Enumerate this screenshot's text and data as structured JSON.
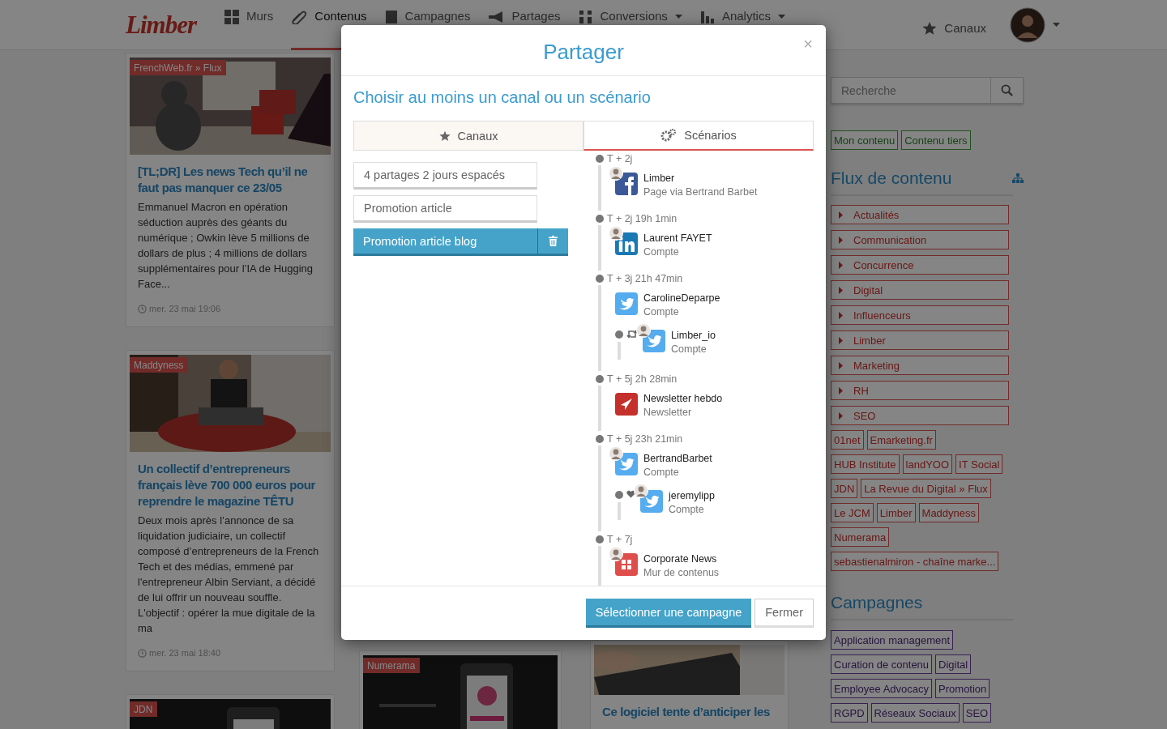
{
  "nav": {
    "logo": "Limber",
    "items": [
      {
        "label": "Murs",
        "selected": false,
        "dropdown": false
      },
      {
        "label": "Contenus",
        "selected": true,
        "dropdown": false
      },
      {
        "label": "Campagnes",
        "selected": false,
        "dropdown": false
      },
      {
        "label": "Partages",
        "selected": false,
        "dropdown": false
      },
      {
        "label": "Conversions",
        "selected": false,
        "dropdown": true
      },
      {
        "label": "Analytics",
        "selected": false,
        "dropdown": true
      }
    ],
    "channels": "Canaux"
  },
  "feed": {
    "columns": [
      {
        "cards": [
          {
            "source": "FrenchWeb.fr » Flux",
            "title": "[TL;DR] Les news Tech qu’il ne faut pas manquer ce 23/05",
            "excerpt": "Emmanuel Macron en opération séduction auprès des géants du numérique ; Owkin lève 5 millions de dollars de plus ; 4 millions de dollars supplémentaires pour l’IA de Hugging Face...",
            "date": "mer. 23 mai 19:06"
          },
          {
            "source": "Maddyness",
            "title": "Un collectif d’entrepreneurs français lève 700 000 euros pour reprendre le magazine TÊTU",
            "excerpt": "Deux mois après l’annonce de sa liquidation judiciaire, un collectif composé d’entrepreneurs de la French Tech et des médias, emmené par l'entrepreneur Albin Serviant, a décidé de lui offrir un nouveau souffle. L'objectif : opérer la mue digitale de la ma",
            "date": "mer. 23 mai 18:40"
          },
          {
            "source": "JDN"
          }
        ]
      },
      {
        "cards": [
          {
            "source": "Numerama"
          }
        ]
      },
      {
        "cards": [
          {
            "title": "Ce logiciel tente d’anticiper les"
          }
        ]
      }
    ]
  },
  "sidebar": {
    "search": {
      "placeholder": "Recherche"
    },
    "filters": [
      "Mon contenu",
      "Contenu tiers"
    ],
    "flux_title": "Flux de contenu",
    "folders": [
      "Actualités",
      "Communication",
      "Concurrence",
      "Digital",
      "Influenceurs",
      "Limber",
      "Marketing",
      "RH",
      "SEO"
    ],
    "sources": [
      "01net",
      "Emarketing.fr",
      "HUB Institute",
      "landYOO",
      "IT Social",
      "JDN",
      "La Revue du Digital » Flux",
      "Le JCM",
      "Limber",
      "Maddyness",
      "Numerama",
      "sebastienalmiron - chaîne marke..."
    ],
    "campaigns_title": "Campagnes",
    "campaigns": [
      "Application management",
      "Curation de contenu",
      "Digital",
      "Employee Advocacy",
      "Promotion",
      "RGPD",
      "Réseaux Sociaux",
      "SEO"
    ]
  },
  "modal": {
    "title": "Partager",
    "close": "×",
    "subtitle": "Choisir au moins un canal ou un scénario",
    "tabs": [
      {
        "label": "Canaux",
        "selected": false
      },
      {
        "label": "Scénarios",
        "selected": true
      }
    ],
    "scenarios": [
      {
        "label": "4 partages 2 jours espacés",
        "selected": false
      },
      {
        "label": "Promotion article",
        "selected": false
      },
      {
        "label": "Promotion article blog",
        "selected": true
      }
    ],
    "timeline": [
      {
        "time": "T + 2j",
        "entries": [
          {
            "kind": "facebook",
            "avatar": true,
            "name": "Limber",
            "detail": "Page via Bertrand Barbet"
          }
        ]
      },
      {
        "time": "T + 2j 19h 1min",
        "entries": [
          {
            "kind": "linkedin",
            "avatar": true,
            "name": "Laurent FAYET",
            "detail": "Compte"
          }
        ]
      },
      {
        "time": "T + 3j 21h 47min",
        "entries": [
          {
            "kind": "twitter",
            "avatar": false,
            "name": "CarolineDeparpe",
            "detail": "Compte",
            "children": [
              {
                "kind": "retweet",
                "avatar": true,
                "name": "Limber_io",
                "detail": "Compte"
              }
            ]
          }
        ]
      },
      {
        "time": "T + 5j 2h 28min",
        "entries": [
          {
            "kind": "newsletter",
            "avatar": false,
            "name": "Newsletter hebdo",
            "detail": "Newsletter"
          }
        ]
      },
      {
        "time": "T + 5j 23h 21min",
        "entries": [
          {
            "kind": "twitter",
            "avatar": true,
            "name": "BertrandBarbet",
            "detail": "Compte",
            "children": [
              {
                "kind": "like",
                "avatar": true,
                "name": "jeremylipp",
                "detail": "Compte"
              }
            ]
          }
        ]
      },
      {
        "time": "T + 7j",
        "entries": [
          {
            "kind": "wall",
            "avatar": true,
            "name": "Corporate News",
            "detail": "Mur de contenus"
          }
        ]
      }
    ],
    "buttons": [
      {
        "label": "Sélectionner une campagne",
        "kind": "primary"
      },
      {
        "label": "Fermer",
        "kind": "default"
      }
    ]
  }
}
